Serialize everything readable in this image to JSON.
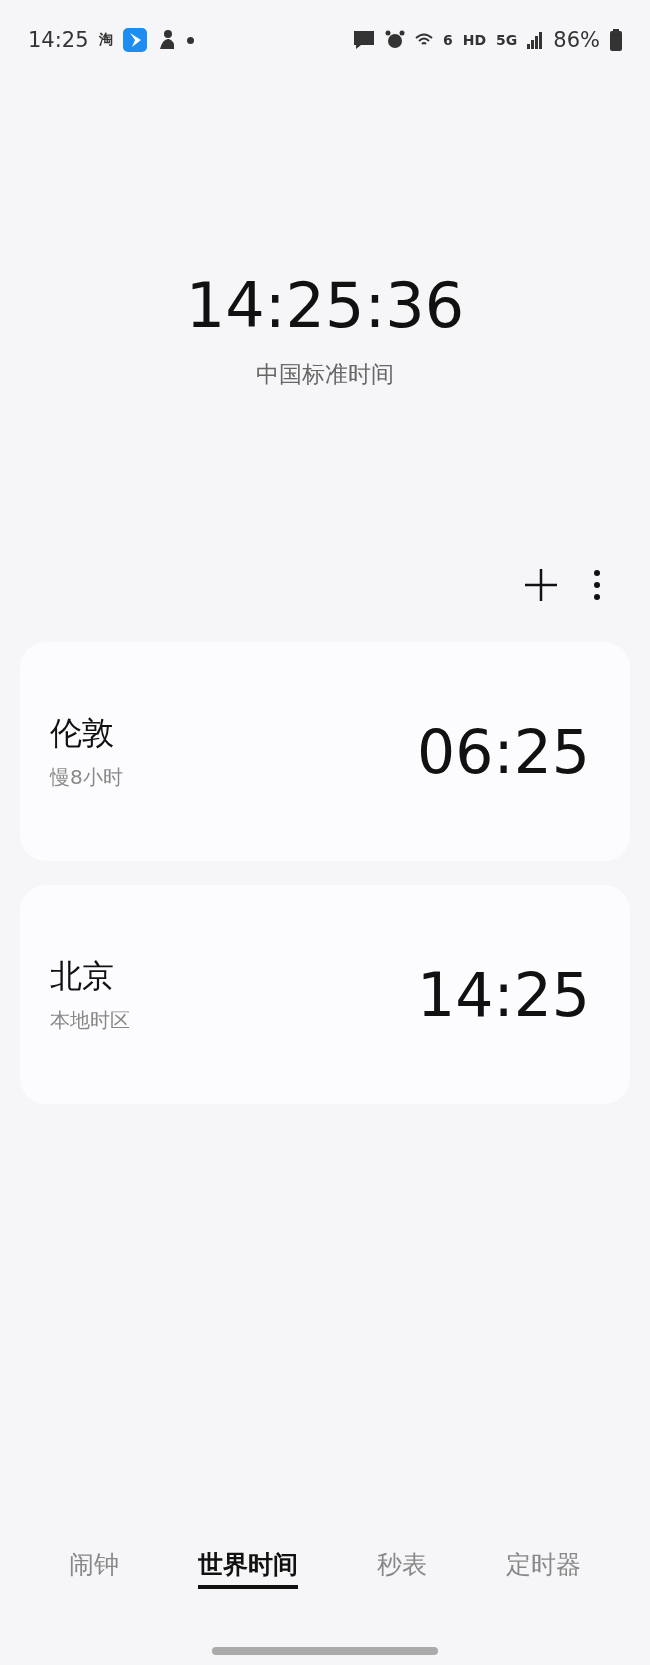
{
  "status_bar": {
    "time": "14:25",
    "notification_glyph": "淘",
    "network_label": "HD",
    "signal_label": "5G",
    "wifi_label": "6",
    "battery": "86%"
  },
  "main_clock": {
    "time": "14:25:36",
    "zone": "中国标准时间"
  },
  "cities": [
    {
      "name": "伦敦",
      "offset": "慢8小时",
      "time": "06:25"
    },
    {
      "name": "北京",
      "offset": "本地时区",
      "time": "14:25"
    }
  ],
  "tabs": [
    {
      "label": "闹钟",
      "selected": false
    },
    {
      "label": "世界时间",
      "selected": true
    },
    {
      "label": "秒表",
      "selected": false
    },
    {
      "label": "定时器",
      "selected": false
    }
  ]
}
